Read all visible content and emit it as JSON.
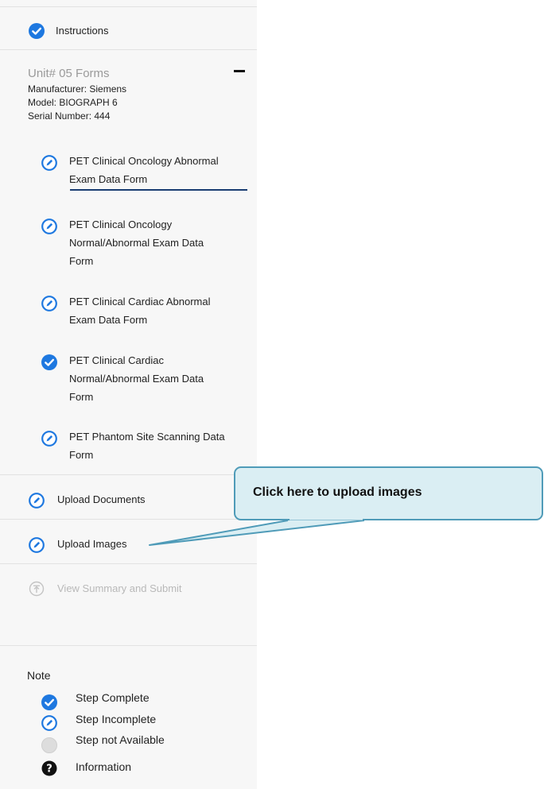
{
  "colors": {
    "accent": "#1e78e0",
    "active_underline": "#1a3d72",
    "callout_fill": "#daeef3",
    "callout_border": "#4f9bb8",
    "disabled": "#b9b9b9"
  },
  "sidebar": {
    "instructions": {
      "label": "Instructions",
      "icon": "check-circle-icon",
      "status": "complete"
    },
    "unit": {
      "title": "Unit# 05 Forms",
      "manufacturer": "Manufacturer: Siemens",
      "model": "Model: BIOGRAPH 6",
      "serial": "Serial Number: 444",
      "collapse_icon": "minus-icon"
    },
    "forms": [
      {
        "lines": [
          "PET Clinical Oncology Abnormal",
          "Exam Data Form"
        ],
        "status": "incomplete",
        "icon": "pencil-circle-icon",
        "active": true
      },
      {
        "lines": [
          "PET Clinical Oncology",
          "Normal/Abnormal Exam Data",
          "Form"
        ],
        "status": "incomplete",
        "icon": "pencil-circle-icon"
      },
      {
        "lines": [
          "PET Clinical Cardiac Abnormal",
          "Exam Data Form"
        ],
        "status": "incomplete",
        "icon": "pencil-circle-icon"
      },
      {
        "lines": [
          "PET Clinical Cardiac",
          "Normal/Abnormal Exam Data",
          "Form"
        ],
        "status": "complete",
        "icon": "check-circle-icon"
      },
      {
        "lines": [
          "PET Phantom Site Scanning Data",
          "Form"
        ],
        "status": "incomplete",
        "icon": "pencil-circle-icon"
      }
    ],
    "upload_documents": {
      "label": "Upload Documents",
      "icon": "pencil-circle-icon",
      "status": "incomplete"
    },
    "upload_images": {
      "label": "Upload Images",
      "icon": "pencil-circle-icon",
      "status": "incomplete"
    },
    "view_summary": {
      "label": "View Summary and Submit",
      "icon": "upload-circle-icon",
      "status": "unavailable"
    }
  },
  "note": {
    "title": "Note",
    "legend": [
      {
        "label": "Step Complete",
        "icon": "check-circle-icon"
      },
      {
        "label": "Step Incomplete",
        "icon": "pencil-circle-icon"
      },
      {
        "label": "Step not Available",
        "icon": "gray-circle-icon"
      },
      {
        "label": "Information",
        "icon": "question-circle-icon"
      }
    ]
  },
  "callout": {
    "text": "Click here to upload images"
  }
}
